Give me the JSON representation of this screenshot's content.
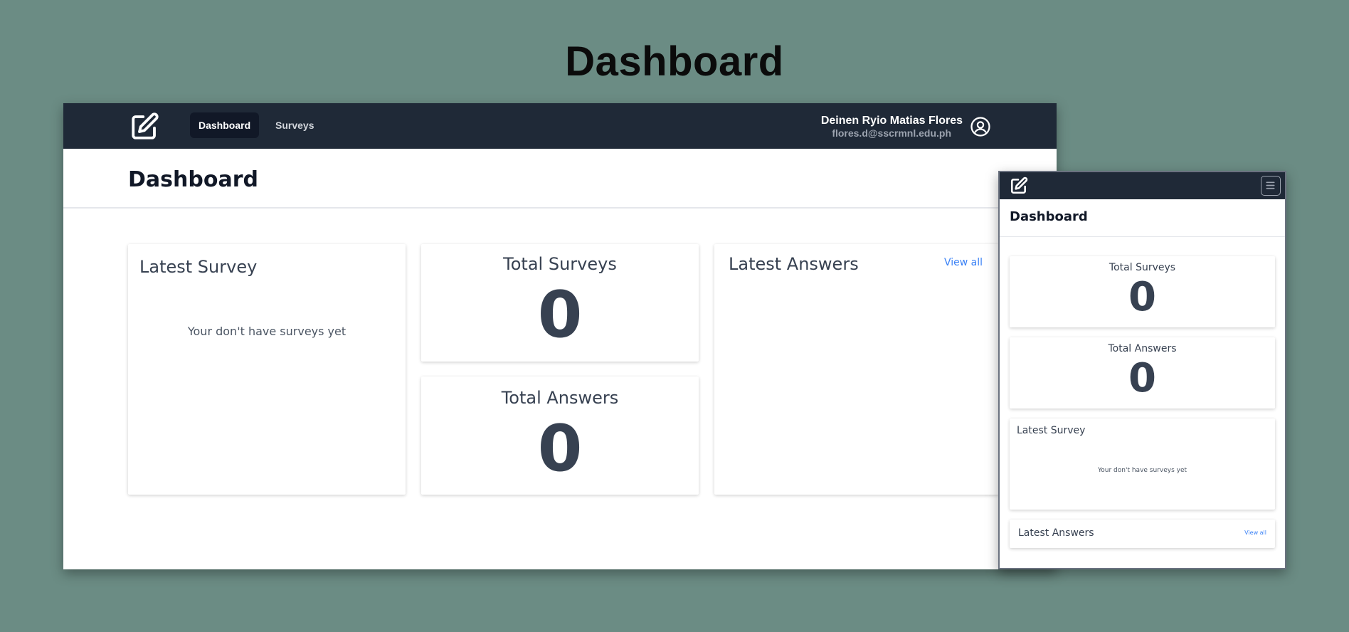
{
  "hero": {
    "title": "Dashboard"
  },
  "desktop": {
    "nav": {
      "tabs": [
        {
          "label": "Dashboard",
          "active": true
        },
        {
          "label": "Surveys",
          "active": false
        }
      ],
      "user": {
        "name": "Deinen Ryio Matias Flores",
        "email": "flores.d@sscrmnl.edu.ph"
      }
    },
    "page_title": "Dashboard",
    "latest_survey": {
      "title": "Latest Survey",
      "empty_text": "Your don't have surveys yet"
    },
    "total_surveys": {
      "title": "Total Surveys",
      "value": "0"
    },
    "total_answers": {
      "title": "Total Answers",
      "value": "0"
    },
    "latest_answers": {
      "title": "Latest Answers",
      "view_all": "View all"
    }
  },
  "mobile": {
    "page_title": "Dashboard",
    "total_surveys": {
      "title": "Total Surveys",
      "value": "0"
    },
    "total_answers": {
      "title": "Total Answers",
      "value": "0"
    },
    "latest_survey": {
      "title": "Latest Survey",
      "empty_text": "Your don't have surveys yet"
    },
    "latest_answers": {
      "title": "Latest Answers",
      "view_all": "View all"
    }
  },
  "colors": {
    "background": "#6b8c84",
    "navbar": "#1f2937",
    "active_tab": "#111827",
    "link": "#3b82f6",
    "text_dark": "#374151"
  },
  "icons": {
    "logo": "edit-square-icon",
    "user": "user-circle-icon",
    "menu": "hamburger-menu-icon"
  }
}
